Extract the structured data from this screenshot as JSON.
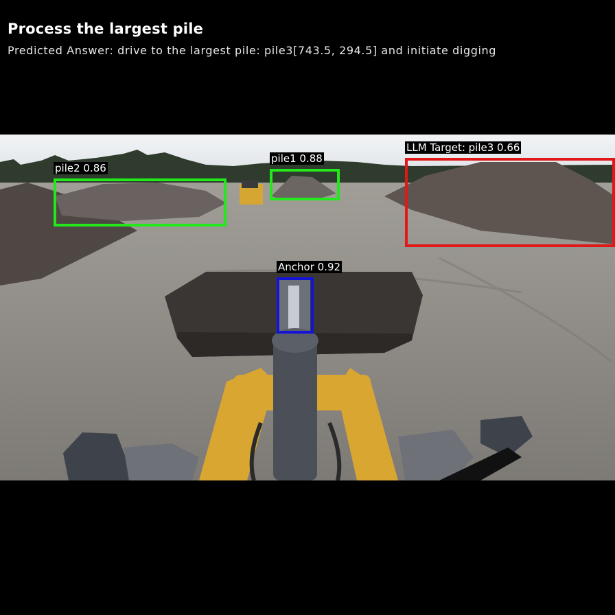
{
  "header": {
    "title": "Process the largest pile",
    "answer": "Predicted Answer: drive to the largest pile: pile3[743.5, 294.5] and initiate digging"
  },
  "detections": {
    "pile2": {
      "label": "pile2 0.86",
      "color": "#22e81c"
    },
    "pile1": {
      "label": "pile1 0.88",
      "color": "#22e81c"
    },
    "target": {
      "label": "LLM Target: pile3 0.66",
      "color": "#e01818"
    },
    "anchor": {
      "label": "Anchor 0.92",
      "color": "#1414d8"
    }
  },
  "colors": {
    "sky": "#e9ecef",
    "ground": "#8f8c87",
    "pile": "#5e5450",
    "machine_yellow": "#d9a632",
    "steel": "#4b4f57"
  }
}
